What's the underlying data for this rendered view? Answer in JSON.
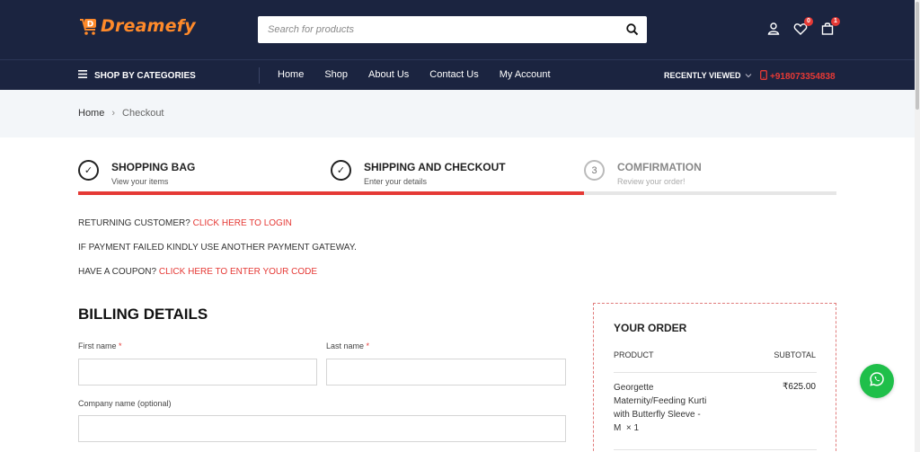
{
  "header": {
    "logo_text": "Dreamefy",
    "logo_letter": "D",
    "search_placeholder": "Search for products",
    "wishlist_count": "0",
    "cart_count": "1"
  },
  "nav": {
    "categories_label": "SHOP BY CATEGORIES",
    "menu": [
      "Home",
      "Shop",
      "About Us",
      "Contact Us",
      "My Account"
    ],
    "recently_viewed": "RECENTLY VIEWED",
    "phone": "+918073354838"
  },
  "breadcrumb": {
    "home": "Home",
    "separator": "›",
    "current": "Checkout"
  },
  "steps": [
    {
      "title": "SHOPPING BAG",
      "subtitle": "View your items",
      "marker": "✓"
    },
    {
      "title": "SHIPPING AND CHECKOUT",
      "subtitle": "Enter your details",
      "marker": "✓"
    },
    {
      "title": "COMFIRMATION",
      "subtitle": "Review your order!",
      "marker": "3"
    }
  ],
  "progress_fraction": 0.667,
  "notices": {
    "returning_text": "RETURNING CUSTOMER?",
    "returning_link": "CLICK HERE TO LOGIN",
    "payment_failed": "IF PAYMENT FAILED KINDLY USE ANOTHER PAYMENT GATEWAY.",
    "coupon_text": "HAVE A COUPON?",
    "coupon_link": "CLICK HERE TO ENTER YOUR CODE"
  },
  "billing": {
    "title": "BILLING DETAILS",
    "first_name_label": "First name",
    "last_name_label": "Last name",
    "company_label": "Company name (optional)",
    "required_mark": "*",
    "first_name_value": "",
    "last_name_value": "",
    "company_value": ""
  },
  "order": {
    "title": "YOUR ORDER",
    "col_product": "PRODUCT",
    "col_subtotal": "SUBTOTAL",
    "item_name": "Georgette Maternity/Feeding Kurti with Butterfly Sleeve - M",
    "item_qty": "× 1",
    "item_price": "₹625.00"
  },
  "colors": {
    "header_bg": "#1b2440",
    "accent_red": "#e53935",
    "logo_orange": "#ff8a2a",
    "whatsapp_green": "#1fbf4a"
  }
}
